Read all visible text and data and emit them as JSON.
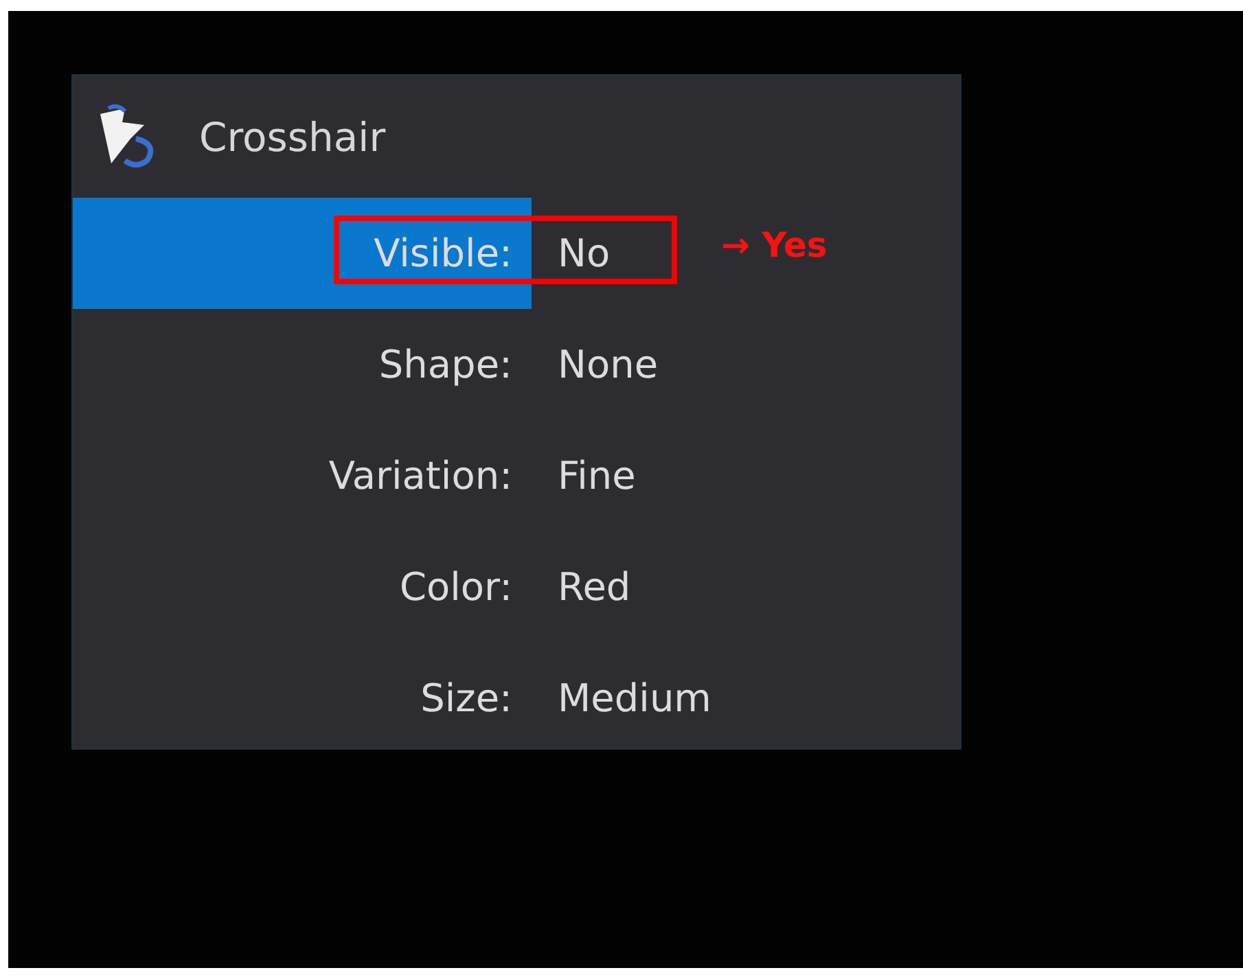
{
  "panel": {
    "title": "Crosshair"
  },
  "rows": [
    {
      "label": "Visible:",
      "value": "No",
      "selected": true,
      "annotated": true
    },
    {
      "label": "Shape:",
      "value": "None",
      "selected": false,
      "annotated": false
    },
    {
      "label": "Variation:",
      "value": "Fine",
      "selected": false,
      "annotated": false
    },
    {
      "label": "Color:",
      "value": "Red",
      "selected": false,
      "annotated": false
    },
    {
      "label": "Size:",
      "value": "Medium",
      "selected": false,
      "annotated": false
    }
  ],
  "annotation": {
    "note": "→ Yes"
  }
}
